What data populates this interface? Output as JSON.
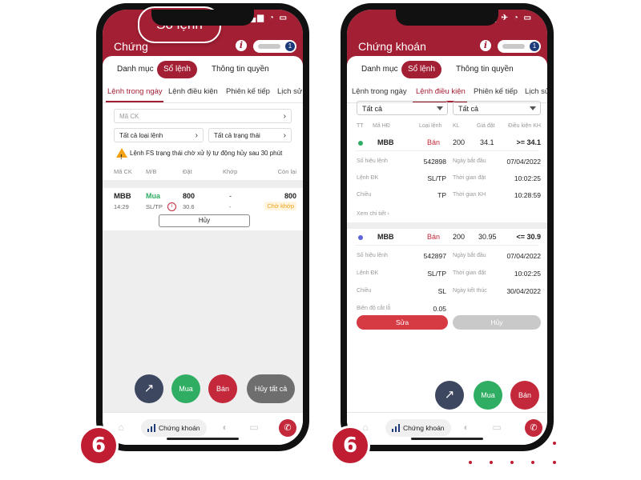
{
  "callout_label": "Sổ lệnh",
  "step_number": "6",
  "colors": {
    "brand": "#a31f34",
    "buy": "#2fae63",
    "sell": "#c4283b",
    "warning": "#f2a114"
  },
  "left": {
    "app_title": "Chứng",
    "top_tabs": [
      "Danh mục",
      "Sổ lệnh",
      "Thông tin quyền"
    ],
    "sub_tabs": [
      "Lệnh trong ngày",
      "Lệnh điều kiện",
      "Phiên kế tiếp",
      "Lịch sử l"
    ],
    "filters": {
      "stock_code": "Mã CK",
      "order_type": "Tất cả loại lệnh",
      "status": "Tất cả trạng thái"
    },
    "warning": "Lệnh FS trạng thái chờ xử lý tự động hủy sau 30 phút",
    "table_headers": [
      "Mã CK",
      "M/B",
      "Đặt",
      "Khớp",
      "Còn lại"
    ],
    "order": {
      "symbol": "MBB",
      "side": "Mua",
      "quantity": "800",
      "matched": "-",
      "remaining": "800",
      "time": "14:29",
      "type": "SL/TP",
      "price": "30.6",
      "matched_price": "-",
      "status": "Chờ khớp"
    },
    "cancel_label": "Hủy",
    "actions": {
      "buy": "Mua",
      "sell": "Bán",
      "cancel_all": "Hủy tất cả"
    },
    "nav": {
      "stocks": "Chứng khoán"
    }
  },
  "right": {
    "app_title": "Chứng khoán",
    "top_tabs": [
      "Danh mục",
      "Sổ lệnh",
      "Thông tin quyền"
    ],
    "sub_tabs": [
      "Lệnh trong ngày",
      "Lệnh điều kiện",
      "Phiên kế tiếp",
      "Lịch sử"
    ],
    "selects": [
      "Tất cả",
      "Tất cả"
    ],
    "table_headers": [
      "TT",
      "Mã HĐ",
      "Loại lệnh",
      "KL",
      "Giá đặt",
      "Điều kiện KH"
    ],
    "order1": {
      "symbol": "MBB",
      "side": "Bán",
      "quantity": "200",
      "price": "34.1",
      "condition": ">= 34.1",
      "labels": [
        "Số hiệu lệnh",
        "Lệnh ĐK",
        "Chiều",
        "Ngày bắt đầu",
        "Thời gian đặt",
        "Thời gian KH"
      ],
      "values": [
        "542898",
        "SL/TP",
        "TP",
        "07/04/2022",
        "10:02:25",
        "10:28:59"
      ],
      "more": "Xem chi tiết"
    },
    "order2": {
      "symbol": "MBB",
      "side": "Bán",
      "quantity": "200",
      "price": "30.95",
      "condition": "<= 30.9",
      "labels": [
        "Số hiệu lệnh",
        "Lệnh ĐK",
        "Chiều",
        "Biên độ cắt lỗ",
        "Ngày bắt đầu",
        "Thời gian đặt",
        "Ngày kết thúc"
      ],
      "values": [
        "542897",
        "SL/TP",
        "SL",
        "0.05",
        "07/04/2022",
        "10:02:25",
        "30/04/2022"
      ]
    },
    "edit_label": "Sửa",
    "cancel_label": "Hủy",
    "actions": {
      "buy": "Mua",
      "sell": "Bán"
    },
    "nav": {
      "stocks": "Chứng khoán"
    }
  }
}
